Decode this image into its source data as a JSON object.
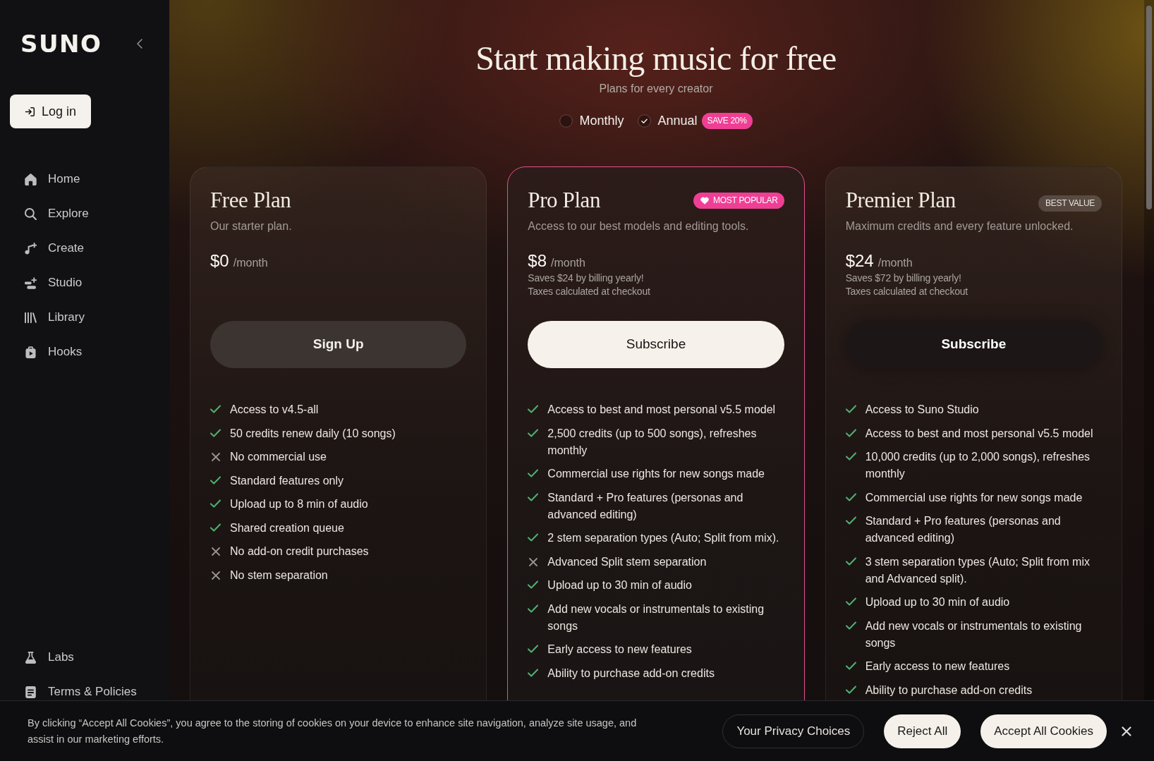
{
  "sidebar": {
    "logo": "SUNO",
    "login_button": "Log in",
    "nav_items": [
      {
        "label": "Home",
        "kind": "home"
      },
      {
        "label": "Explore",
        "kind": "explore"
      },
      {
        "label": "Create",
        "kind": "create"
      },
      {
        "label": "Studio",
        "kind": "studio"
      },
      {
        "label": "Library",
        "kind": "library"
      },
      {
        "label": "Hooks",
        "kind": "hooks"
      }
    ],
    "footer_items": [
      {
        "label": "Labs",
        "kind": "labs"
      },
      {
        "label": "Terms & Policies",
        "kind": "terms"
      }
    ]
  },
  "header": {
    "title": "Start making music for free",
    "subtitle": "Plans for every creator",
    "billing_options": [
      {
        "label": "Monthly",
        "selected": false
      },
      {
        "label": "Annual",
        "selected": true,
        "badge": "SAVE 20%"
      }
    ]
  },
  "plans": [
    {
      "name": "Free Plan",
      "featured": false,
      "description": "Our starter plan.",
      "price": "$0",
      "period": "/month",
      "button": {
        "label": "Sign Up",
        "kind": "muted"
      },
      "features": [
        {
          "text": "Access to v4.5-all",
          "included": true
        },
        {
          "text": "50 credits renew daily (10 songs)",
          "included": true
        },
        {
          "text": "No commercial use",
          "included": false
        },
        {
          "text": "Standard features only",
          "included": true
        },
        {
          "text": "Upload up to 8 min of audio",
          "included": true
        },
        {
          "text": "Shared creation queue",
          "included": true
        },
        {
          "text": "No add-on credit purchases",
          "included": false
        },
        {
          "text": "No stem separation",
          "included": false
        }
      ]
    },
    {
      "name": "Pro Plan",
      "featured": true,
      "badge": {
        "label": "MOST POPULAR",
        "kind": "popular"
      },
      "description": "Access to our best models and editing tools.",
      "price": "$8",
      "period": "/month",
      "notes": [
        "Saves $24 by billing yearly!",
        "Taxes calculated at checkout"
      ],
      "button": {
        "label": "Subscribe",
        "kind": "light"
      },
      "features": [
        {
          "text": "Access to best and most personal v5.5 model",
          "included": true
        },
        {
          "text": "2,500 credits (up to 500 songs), refreshes monthly",
          "included": true
        },
        {
          "text": "Commercial use rights for new songs made",
          "included": true
        },
        {
          "text": "Standard + Pro features (personas and advanced editing)",
          "included": true
        },
        {
          "text": "2 stem separation types (Auto; Split from mix).",
          "included": true
        },
        {
          "text": "Advanced Split stem separation",
          "included": false
        },
        {
          "text": "Upload up to 30 min of audio",
          "included": true
        },
        {
          "text": "Add new vocals or instrumentals to existing songs",
          "included": true
        },
        {
          "text": "Early access to new features",
          "included": true
        },
        {
          "text": "Ability to purchase add-on credits",
          "included": true
        }
      ]
    },
    {
      "name": "Premier Plan",
      "featured": false,
      "badge": {
        "label": "BEST VALUE",
        "kind": "value"
      },
      "description": "Maximum credits and every feature unlocked.",
      "price": "$24",
      "period": "/month",
      "notes": [
        "Saves $72 by billing yearly!",
        "Taxes calculated at checkout"
      ],
      "button": {
        "label": "Subscribe",
        "kind": "dark"
      },
      "features": [
        {
          "text": "Access to Suno Studio",
          "included": true
        },
        {
          "text": "Access to best and most personal v5.5 model",
          "included": true
        },
        {
          "text": "10,000 credits (up to 2,000 songs), refreshes monthly",
          "included": true
        },
        {
          "text": "Commercial use rights for new songs made",
          "included": true
        },
        {
          "text": "Standard + Pro features (personas and advanced editing)",
          "included": true
        },
        {
          "text": "3 stem separation types (Auto; Split from mix and Advanced split).",
          "included": true
        },
        {
          "text": "Upload up to 30 min of audio",
          "included": true
        },
        {
          "text": "Add new vocals or instrumentals to existing songs",
          "included": true
        },
        {
          "text": "Early access to new features",
          "included": true
        },
        {
          "text": "Ability to purchase add-on credits",
          "included": true
        }
      ]
    }
  ],
  "cookie_banner": {
    "text": "By clicking “Accept All Cookies”, you agree to the storing of cookies on your device to enhance site navigation, analyze site usage, and assist in our marketing efforts.",
    "buttons": [
      {
        "label": "Your Privacy Choices",
        "kind": "outline"
      },
      {
        "label": "Reject All",
        "kind": "light"
      },
      {
        "label": "Accept All Cookies",
        "kind": "light"
      }
    ]
  }
}
